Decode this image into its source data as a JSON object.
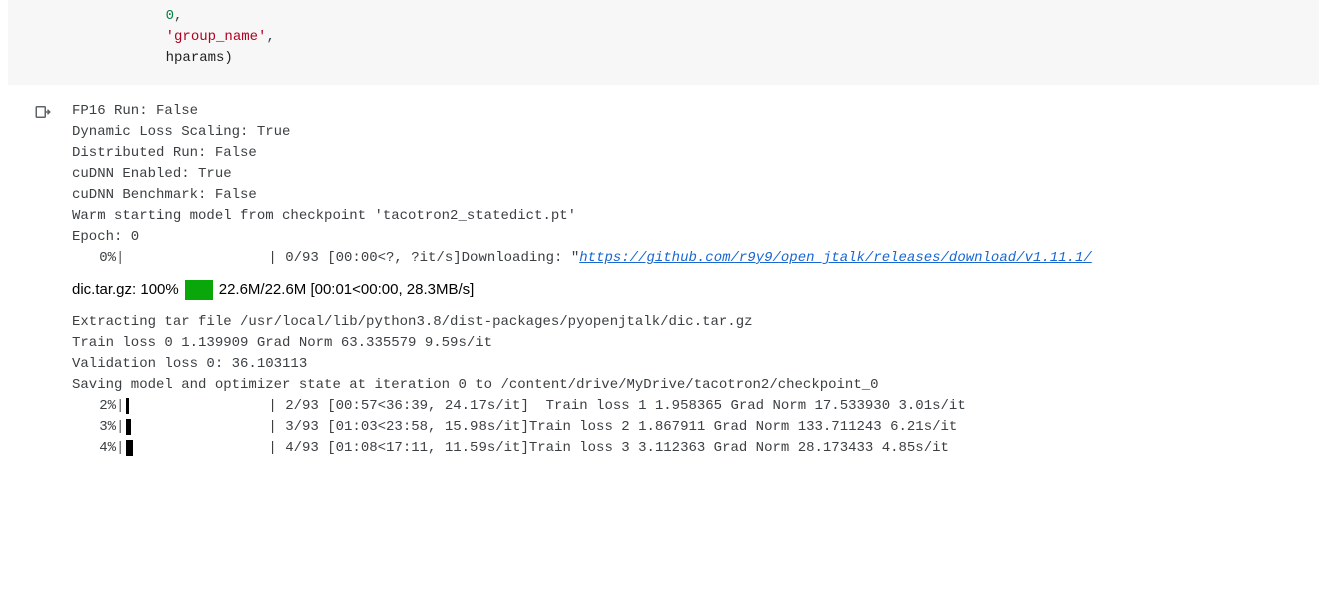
{
  "code": {
    "indent": "              ",
    "lines": [
      {
        "num": "0",
        "suffix": ","
      },
      {
        "str": "'group_name'",
        "suffix": ","
      },
      {
        "plain": "hparams)"
      }
    ]
  },
  "output": {
    "fp16": "FP16 Run: False",
    "dyn_loss": "Dynamic Loss Scaling: True",
    "dist_run": "Distributed Run: False",
    "cudnn_en": "cuDNN Enabled: True",
    "cudnn_bm": "cuDNN Benchmark: False",
    "warm": "Warm starting model from checkpoint 'tacotron2_statedict.pt'",
    "epoch": "Epoch: 0",
    "bar0_pct": "0%",
    "bar0_tail": "| 0/93 [00:00<?, ?it/s]Downloading: \"",
    "link": "https://github.com/r9y9/open_jtalk/releases/download/v1.11.1/",
    "dl_label": "dic.tar.gz: 100%",
    "dl_stats": "22.6M/22.6M [00:01<00:00, 28.3MB/s]",
    "extract": "Extracting tar file /usr/local/lib/python3.8/dist-packages/pyopenjtalk/dic.tar.gz",
    "train0": "Train loss 0 1.139909 Grad Norm 63.335579 9.59s/it",
    "val0": "Validation loss 0: 36.103113",
    "saving": "Saving model and optimizer state at iteration 0 to /content/drive/MyDrive/tacotron2/checkpoint_0",
    "bars": [
      {
        "pct": "2%",
        "fill": 3,
        "text": "| 2/93 [00:57<36:39, 24.17s/it]  Train loss 1 1.958365 Grad Norm 17.533930 3.01s/it"
      },
      {
        "pct": "3%",
        "fill": 5,
        "text": "| 3/93 [01:03<23:58, 15.98s/it]Train loss 2 1.867911 Grad Norm 133.711243 6.21s/it"
      },
      {
        "pct": "4%",
        "fill": 7,
        "text": "| 4/93 [01:08<17:11, 11.59s/it]Train loss 3 3.112363 Grad Norm 28.173433 4.85s/it"
      }
    ]
  },
  "icons": {
    "output_gutter": "output-arrow-icon"
  },
  "colors": {
    "progress_green": "#0aa70a",
    "link": "#1967d2",
    "string": "#b00020",
    "number": "#0b8043"
  }
}
